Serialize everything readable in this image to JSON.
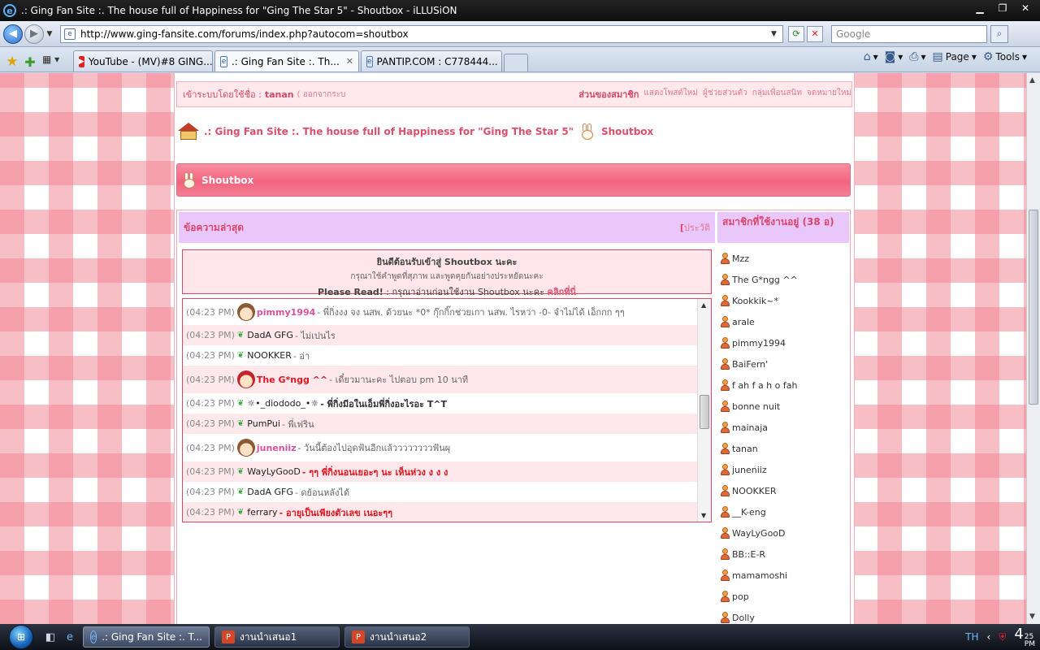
{
  "window": {
    "title": ".: Ging Fan Site :. The house full of Happiness for \"Ging The Star 5\" - Shoutbox - iLLUSiON",
    "controls": [
      "minimize",
      "restore",
      "close"
    ]
  },
  "addressbar": {
    "url": "http://www.ging-fansite.com/forums/index.php?autocom=shoutbox",
    "search_placeholder": "Google"
  },
  "tabs": [
    {
      "label": "YouTube - (MV)#8 GING...",
      "icon": "youtube-icon",
      "active": false
    },
    {
      "label": ".: Ging Fan Site :. Th...",
      "icon": "ie-page-icon",
      "active": true
    },
    {
      "label": "PANTIP.COM : C778444...",
      "icon": "ie-page-icon",
      "active": false
    }
  ],
  "commandbar": {
    "page_label": "Page",
    "tools_label": "Tools"
  },
  "forum": {
    "userbar": {
      "login_prefix": "เข้าระบบโดยใช้ชื่อ :",
      "username": "tanan",
      "logout": "( ออกจากระบ",
      "my_controls": "ส่วนของสมาชิก",
      "new_posts": "แสดงโพสต์ใหม่",
      "my_assistant": "ผู้ช่วยส่วนตัว",
      "my_friends": "กลุ่มเพื่อนสนิท",
      "messages": "จดหมายใหม่"
    },
    "breadcrumb": {
      "site": ".: Ging Fan Site :. The house full of Happiness for \"Ging The Star 5\"",
      "current": "Shoutbox"
    },
    "section_title": "Shoutbox",
    "latest_label": "ข้อความล่าสุด",
    "history_bracket": "[",
    "history_label": "ประวัติ",
    "online_label": "สมาชิกที่ใช้งานอยู่ (38 อ)",
    "welcome": {
      "title": "ยินดีต้อนรับเข้าสู่ Shoutbox นะคะ",
      "subtitle": "กรุณาใช้คำพูดที่สุภาพ และพูดคุยกันอย่างประหยัดนะคะ",
      "please_read": "Please Read!",
      "read_text": ": กรุณาอ่านก่อนใช้งาน Shoutbox นะคะ",
      "link": "คลิกที่นี่"
    },
    "messages": [
      {
        "time": "(04:23 PM)",
        "nick": "pimmy1994",
        "text": "- พี่กิ่งงง จง นสพ. ด้วยนะ *0* กุ๊กกิ๊กช่วยเกา นสพ. ไรหว่า -0- จำไม่ได้ เอ็กกก ๆๆ",
        "style": "avatar-pink"
      },
      {
        "time": "(04:23 PM)",
        "nick": "DadA GFG",
        "text": "- ไม่เปนไร",
        "style": "sprout"
      },
      {
        "time": "(04:23 PM)",
        "nick": "NOOKKER",
        "text": "- อ่า",
        "style": "sprout"
      },
      {
        "time": "(04:23 PM)",
        "nick": "The G*ngg ^^",
        "text": "- เดี๋ยวมานะคะ ไปตอบ pm 10 นาที",
        "style": "avatar-red"
      },
      {
        "time": "(04:23 PM)",
        "nick": "☼•_diododo_•☼",
        "text": "- พี่กิ่งมีอในเอ็มพี่กิ่งอะไรอะ T^T",
        "style": "sprout-dark"
      },
      {
        "time": "(04:23 PM)",
        "nick": "PumPui",
        "text": "- พี่เฟริน",
        "style": "sprout"
      },
      {
        "time": "(04:23 PM)",
        "nick": "juneniiz",
        "text": "- วันนี้ต้องไปอุดฟันอีกแล้ววววววววฟันผุ",
        "style": "avatar-pink"
      },
      {
        "time": "(04:23 PM)",
        "nick": "WayLyGooD",
        "text": "- ๆๆ พี่กิ่งนอนเยอะๆ นะ เห็นห่วง ง ง ง",
        "style": "sprout-red"
      },
      {
        "time": "(04:23 PM)",
        "nick": "DadA GFG",
        "text": "- ดย้อนหลังได้",
        "style": "sprout"
      },
      {
        "time": "(04:23 PM)",
        "nick": "ferrary",
        "text": "- อายุเป็นเพียงตัวเลข เนอะๆๆ",
        "style": "sprout-red"
      }
    ],
    "online_members": [
      "Mzz",
      "The G*ngg ^^",
      "Kookkik~*",
      "arale",
      "pimmy1994",
      "BaiFern'",
      "f ah f a h o fah",
      "bonne nuit",
      "mainaja",
      "tanan",
      "juneniiz",
      "NOOKKER",
      "__K-eng",
      "WayLyGooD",
      "BB::E-R",
      "mamamoshi",
      "pop",
      "Dolly"
    ]
  },
  "taskbar": {
    "buttons": [
      {
        "label": ".: Ging Fan Site :. T...",
        "icon": "ie-icon",
        "active": true
      },
      {
        "label": "งานนำเสนอ1",
        "icon": "powerpoint-icon",
        "active": false
      },
      {
        "label": "งานนำเสนอ2",
        "icon": "powerpoint-icon",
        "active": false
      }
    ],
    "language": "TH",
    "clock_hour": "4",
    "clock_min": "25",
    "clock_ampm": "PM"
  }
}
